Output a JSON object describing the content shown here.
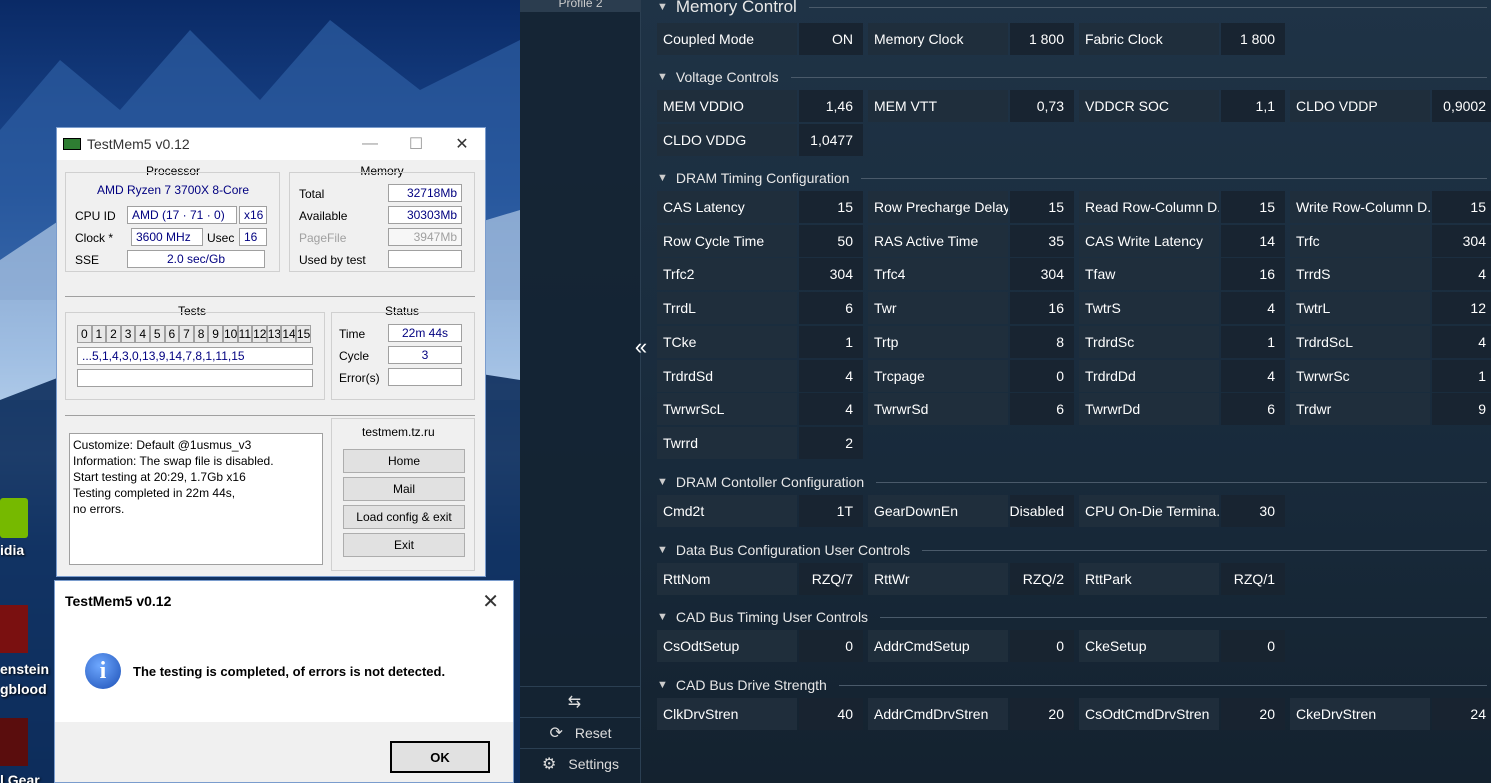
{
  "desktop": {
    "icons": [
      {
        "name": "nvidia-icon",
        "label": "idia"
      },
      {
        "name": "wolfenstein-icon",
        "label": "enstein\ngblood"
      },
      {
        "name": "gear-game-icon",
        "label": "l Gear"
      }
    ]
  },
  "testmem": {
    "title": "TestMem5 v0.12",
    "processor": {
      "title": "Processor",
      "name": "AMD Ryzen 7 3700X 8-Core",
      "cpuid_label": "CPU ID",
      "cpuid": "AMD  (17 · 71 · 0)",
      "cpuid_x": "x16",
      "clock_label": "Clock *",
      "clock": "3600 MHz",
      "usec_label": "Usec",
      "usec": "16",
      "sse_label": "SSE",
      "sse": "2.0 sec/Gb"
    },
    "memory": {
      "title": "Memory",
      "total_label": "Total",
      "total": "32718Mb",
      "available_label": "Available",
      "available": "30303Mb",
      "pagefile_label": "PageFile",
      "pagefile": "3947Mb",
      "usedby_label": "Used by test",
      "usedby": ""
    },
    "tests": {
      "title": "Tests",
      "cells": [
        "0",
        "1",
        "2",
        "3",
        "4",
        "5",
        "6",
        "7",
        "8",
        "9",
        "10",
        "11",
        "12",
        "13",
        "14",
        "15"
      ],
      "sequence": "...5,1,4,3,0,13,9,14,7,8,1,11,15"
    },
    "status": {
      "title": "Status",
      "time_label": "Time",
      "time": "22m 44s",
      "cycle_label": "Cycle",
      "cycle": "3",
      "errors_label": "Error(s)",
      "errors": ""
    },
    "log": [
      "Customize: Default @1usmus_v3",
      "Information: The swap file is disabled.",
      "Start testing at 20:29, 1.7Gb x16",
      "Testing completed in 22m 44s,",
      "no errors."
    ],
    "site": "testmem.tz.ru",
    "buttons": {
      "home": "Home",
      "mail": "Mail",
      "load": "Load config & exit",
      "exit": "Exit"
    }
  },
  "dialog": {
    "title": "TestMem5 v0.12",
    "message": "The testing is completed, of errors is not detected.",
    "ok": "OK"
  },
  "ryzen": {
    "profile_tab": "Profile 2",
    "nav": {
      "reset": "Reset",
      "settings": "Settings"
    },
    "sections": [
      {
        "title": "Memory Control",
        "rows": [
          [
            [
              "Coupled Mode",
              "ON"
            ],
            [
              "Memory Clock",
              "1 800"
            ],
            [
              "Fabric Clock",
              "1 800"
            ]
          ]
        ]
      },
      {
        "title": "Voltage Controls",
        "rows": [
          [
            [
              "MEM VDDIO",
              "1,46"
            ],
            [
              "MEM VTT",
              "0,73"
            ],
            [
              "VDDCR SOC",
              "1,1"
            ],
            [
              "CLDO VDDP",
              "0,9002"
            ]
          ],
          [
            [
              "CLDO VDDG",
              "1,0477"
            ]
          ]
        ]
      },
      {
        "title": "DRAM Timing Configuration",
        "rows": [
          [
            [
              "CAS Latency",
              "15"
            ],
            [
              "Row Precharge Delay",
              "15"
            ],
            [
              "Read Row-Column D...",
              "15"
            ],
            [
              "Write Row-Column D...",
              "15"
            ]
          ],
          [
            [
              "Row Cycle Time",
              "50"
            ],
            [
              "RAS Active Time",
              "35"
            ],
            [
              "CAS Write Latency",
              "14"
            ],
            [
              "Trfc",
              "304"
            ]
          ],
          [
            [
              "Trfc2",
              "304"
            ],
            [
              "Trfc4",
              "304"
            ],
            [
              "Tfaw",
              "16"
            ],
            [
              "TrrdS",
              "4"
            ]
          ],
          [
            [
              "TrrdL",
              "6"
            ],
            [
              "Twr",
              "16"
            ],
            [
              "TwtrS",
              "4"
            ],
            [
              "TwtrL",
              "12"
            ]
          ],
          [
            [
              "TCke",
              "1"
            ],
            [
              "Trtp",
              "8"
            ],
            [
              "TrdrdSc",
              "1"
            ],
            [
              "TrdrdScL",
              "4"
            ]
          ],
          [
            [
              "TrdrdSd",
              "4"
            ],
            [
              "Trcpage",
              "0"
            ],
            [
              "TrdrdDd",
              "4"
            ],
            [
              "TwrwrSc",
              "1"
            ]
          ],
          [
            [
              "TwrwrScL",
              "4"
            ],
            [
              "TwrwrSd",
              "6"
            ],
            [
              "TwrwrDd",
              "6"
            ],
            [
              "Trdwr",
              "9"
            ]
          ],
          [
            [
              "Twrrd",
              "2"
            ]
          ]
        ]
      },
      {
        "title": "DRAM Contoller Configuration",
        "rows": [
          [
            [
              "Cmd2t",
              "1T"
            ],
            [
              "GearDownEn",
              "Disabled"
            ],
            [
              "CPU On-Die Termina...",
              "30"
            ]
          ]
        ]
      },
      {
        "title": "Data Bus Configuration User Controls",
        "rows": [
          [
            [
              "RttNom",
              "RZQ/7"
            ],
            [
              "RttWr",
              "RZQ/2"
            ],
            [
              "RttPark",
              "RZQ/1"
            ]
          ]
        ]
      },
      {
        "title": "CAD Bus Timing User Controls",
        "rows": [
          [
            [
              "CsOdtSetup",
              "0"
            ],
            [
              "AddrCmdSetup",
              "0"
            ],
            [
              "CkeSetup",
              "0"
            ]
          ]
        ]
      },
      {
        "title": "CAD Bus Drive Strength",
        "rows": [
          [
            [
              "ClkDrvStren",
              "40"
            ],
            [
              "AddrCmdDrvStren",
              "20"
            ],
            [
              "CsOdtCmdDrvStren",
              "20"
            ],
            [
              "CkeDrvStren",
              "24"
            ]
          ]
        ]
      }
    ]
  }
}
